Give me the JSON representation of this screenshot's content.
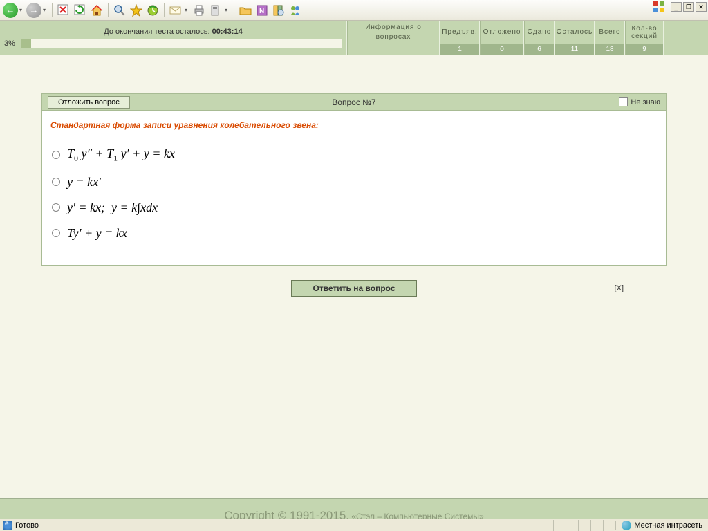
{
  "timer": {
    "label": "До окончания теста осталось: ",
    "value": "00:43:14"
  },
  "progress": {
    "pct": "3%"
  },
  "cols": {
    "info": "Информация о вопросах",
    "pred": {
      "h": "Предъяв.",
      "v": "1"
    },
    "otl": {
      "h": "Отложено",
      "v": "0"
    },
    "sd": {
      "h": "Сдано",
      "v": "6"
    },
    "ost": {
      "h": "Осталось",
      "v": "11"
    },
    "vse": {
      "h": "Всего",
      "v": "18"
    },
    "sek": {
      "h": "Кол-во секций",
      "v": "9"
    }
  },
  "question": {
    "postpone": "Отложить вопрос",
    "title": "Вопрос №7",
    "dontknow": "Не знаю",
    "text": "Стандартная форма записи уравнения колебательного звена:",
    "submit": "Ответить на вопрос",
    "close": "[X]"
  },
  "footer": {
    "copy": "Copyright © 1991-2015.",
    "org": " «Стэл – Компьютерные Системы»"
  },
  "status": {
    "ready": "Готово",
    "zone": "Местная интрасеть"
  }
}
